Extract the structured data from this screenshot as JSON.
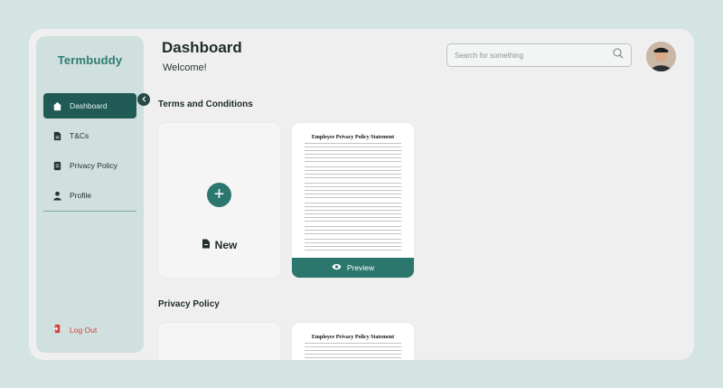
{
  "app": {
    "brand": "Termbuddy",
    "accent": "#2b776d",
    "sidebar_active": "#1f5a55",
    "logout_color": "#d8403c"
  },
  "sidebar": {
    "items": [
      {
        "label": "Dashboard",
        "icon": "home-icon",
        "active": true
      },
      {
        "label": "T&Cs",
        "icon": "document-icon",
        "active": false
      },
      {
        "label": "Privacy Policy",
        "icon": "policy-icon",
        "active": false
      },
      {
        "label": "Profile",
        "icon": "user-icon",
        "active": false
      }
    ],
    "logout_label": "Log Out",
    "collapse_icon": "chevron-left-icon"
  },
  "header": {
    "title": "Dashboard",
    "welcome": "Welcome!",
    "search_placeholder": "Search for something",
    "search_icon": "search-icon"
  },
  "sections": {
    "terms": {
      "title": "Terms and Conditions",
      "new_label": "New",
      "doc_title": "Employee Privacy Policy Statement",
      "preview_label": "Preview"
    },
    "privacy": {
      "title": "Privacy Policy",
      "doc_title": "Employee Privacy Policy Statement"
    }
  }
}
